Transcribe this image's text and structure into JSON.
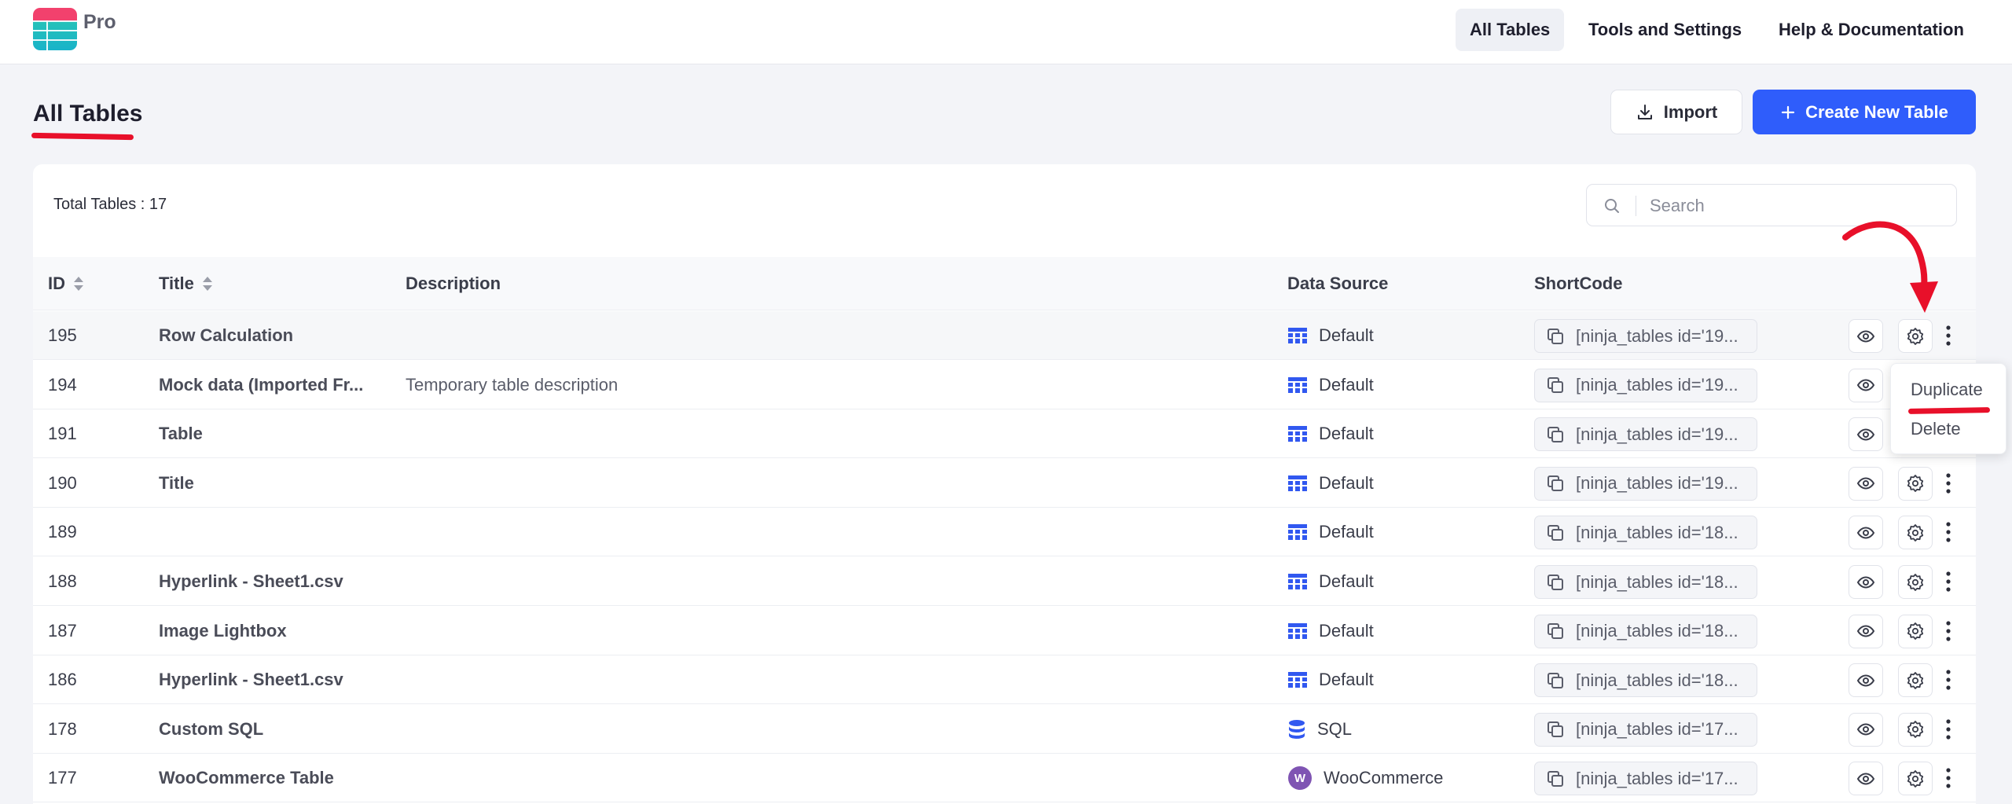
{
  "brand": {
    "name": "Pro"
  },
  "nav": [
    {
      "label": "All Tables",
      "active": true
    },
    {
      "label": "Tools and Settings",
      "active": false
    },
    {
      "label": "Help & Documentation",
      "active": false
    }
  ],
  "page": {
    "title": "All Tables"
  },
  "actions": {
    "import_label": "Import",
    "create_label": "Create New Table"
  },
  "table": {
    "total_label": "Total Tables : 17",
    "search_placeholder": "Search",
    "columns": {
      "id": "ID",
      "title": "Title",
      "description": "Description",
      "data_source": "Data Source",
      "shortcode": "ShortCode"
    },
    "rows": [
      {
        "id": "195",
        "title": "Row Calculation",
        "description": "",
        "source": "Default",
        "source_icon": "table-grid-icon",
        "shortcode": "[ninja_tables id='19..."
      },
      {
        "id": "194",
        "title": "Mock data (Imported Fr...",
        "description": "Temporary table description",
        "source": "Default",
        "source_icon": "table-grid-icon",
        "shortcode": "[ninja_tables id='19..."
      },
      {
        "id": "191",
        "title": "Table",
        "description": "",
        "source": "Default",
        "source_icon": "table-grid-icon",
        "shortcode": "[ninja_tables id='19..."
      },
      {
        "id": "190",
        "title": "Title",
        "description": "",
        "source": "Default",
        "source_icon": "table-grid-icon",
        "shortcode": "[ninja_tables id='19..."
      },
      {
        "id": "189",
        "title": "",
        "description": "",
        "source": "Default",
        "source_icon": "table-grid-icon",
        "shortcode": "[ninja_tables id='18..."
      },
      {
        "id": "188",
        "title": "Hyperlink - Sheet1.csv",
        "description": "",
        "source": "Default",
        "source_icon": "table-grid-icon",
        "shortcode": "[ninja_tables id='18..."
      },
      {
        "id": "187",
        "title": "Image Lightbox",
        "description": "",
        "source": "Default",
        "source_icon": "table-grid-icon",
        "shortcode": "[ninja_tables id='18..."
      },
      {
        "id": "186",
        "title": "Hyperlink - Sheet1.csv",
        "description": "",
        "source": "Default",
        "source_icon": "table-grid-icon",
        "shortcode": "[ninja_tables id='18..."
      },
      {
        "id": "178",
        "title": "Custom SQL",
        "description": "",
        "source": "SQL",
        "source_icon": "database-icon",
        "shortcode": "[ninja_tables id='17..."
      },
      {
        "id": "177",
        "title": "WooCommerce Table",
        "description": "",
        "source": "WooCommerce",
        "source_icon": "woocommerce-icon",
        "shortcode": "[ninja_tables id='17..."
      }
    ]
  },
  "row_menu": {
    "duplicate_label": "Duplicate",
    "delete_label": "Delete"
  },
  "colors": {
    "accent": "#2f5dfb",
    "annotation_red": "#e8102a",
    "source_icon_blue": "#3158f0",
    "woocommerce_purple": "#7f54b3"
  }
}
